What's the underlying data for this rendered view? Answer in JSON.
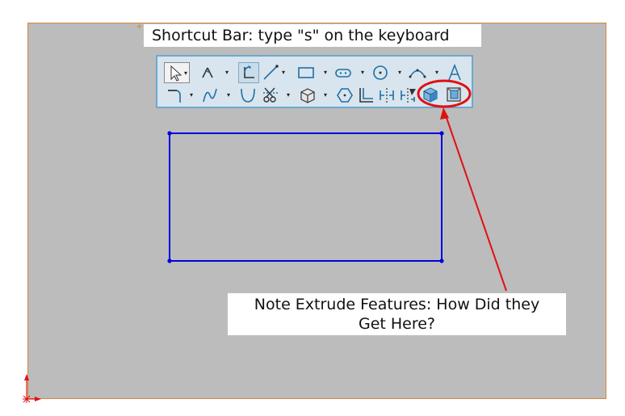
{
  "title_label": "Shortcut Bar: type \"s\" on the keyboard",
  "note_label_line1": "Note Extrude Features: How Did they",
  "note_label_line2": "Get Here?",
  "colors": {
    "canvas_bg": "#bcbcbc",
    "canvas_border": "#d0883a",
    "toolbar_bg": "#d8e4ee",
    "toolbar_border": "#6da9cc",
    "sketch_line": "#0000e0",
    "annotation": "#e11010",
    "icon_blue": "#1f6fa6"
  },
  "toolbar": {
    "row1": [
      "select-icon",
      "smart-dimension-icon",
      "sketch-icon",
      "line-icon",
      "rectangle-icon",
      "slot-icon",
      "circle-icon",
      "arc-icon",
      "text-icon"
    ],
    "row2": [
      "fillet-icon",
      "spline-icon",
      "ellipse-icon",
      "trim-icon",
      "plane-icon",
      "polygon-icon",
      "offset-icon",
      "mirror-icon",
      "dynamic-mirror-icon",
      "extruded-boss-icon",
      "extruded-cut-icon"
    ]
  }
}
